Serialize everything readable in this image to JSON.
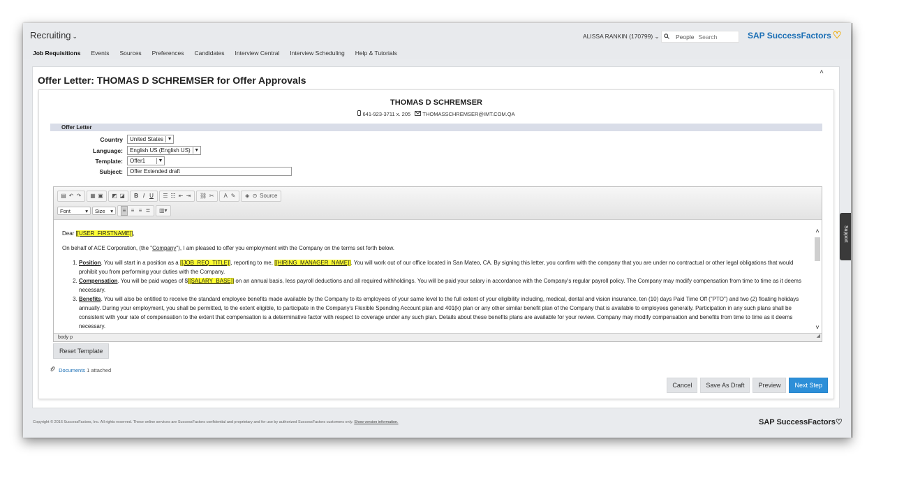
{
  "app": {
    "title": "Recruiting",
    "chevron": "⌄"
  },
  "nav": [
    "Job Requisitions",
    "Events",
    "Sources",
    "Preferences",
    "Candidates",
    "Interview Central",
    "Interview Scheduling",
    "Help & Tutorials"
  ],
  "header": {
    "user": "ALISSA RANKIN (170799) ⌄",
    "search_scope": "People",
    "search_placeholder": "Search",
    "brand": "SAP SuccessFactors",
    "brand_heart": "♡"
  },
  "page": {
    "title": "Offer Letter: THOMAS D SCHREMSER for Offer Approvals",
    "collapse_icon": "˄"
  },
  "candidate": {
    "name": "THOMAS D SCHREMSER",
    "phone": "641-923-3711 x. 205",
    "email": "THOMASSCHREMSER@IMT.COM.QA"
  },
  "section": {
    "title": "Offer Letter"
  },
  "form": {
    "country_label": "Country",
    "country_value": "United States",
    "language_label": "Language:",
    "language_value": "English US (English US)",
    "template_label": "Template:",
    "template_value": "Offer1",
    "subject_label": "Subject:",
    "subject_value": "Offer Extended draft"
  },
  "toolbar": {
    "source_label": "Source",
    "font_label": "Font",
    "size_label": "Size",
    "bold": "B",
    "italic": "I",
    "underline": "U"
  },
  "letter": {
    "dear": "Dear ",
    "user_firstname": "[[USER_FIRSTNAME]]",
    "dear_end": ",",
    "intro_a": "On behalf of ACE Corporation, (the \"",
    "intro_company": "Company",
    "intro_b": "\"), I am pleased to offer you employment with the Company on the terms set forth below.",
    "position_head": "Position",
    "position_a": ". You will start in a position as a ",
    "job_title": "[[JOB_REQ_TITLE]]",
    "position_b": ", reporting to me, ",
    "hiring_manager": "[[HIRING_MANAGER_NAME]]",
    "position_c": ". You will work out of our office located in San Mateo, CA. By signing this letter, you confirm with the company that you are under no contractual or other legal obligations that would prohibit you from performing your duties with the Company.",
    "comp_head": "Compensation",
    "comp_a": ". You will be paid wages of $",
    "salary_base": "[[SALARY_BASE]]",
    "comp_b": " on an annual basis, less payroll deductions and all required withholdings. You will be paid your salary in accordance with the Company's regular payroll policy. The Company may modify compensation from time to time as it deems necessary.",
    "benefits_head": "Benefits",
    "benefits_a": ". You will also be entitled to receive the standard employee benefits made available by the Company to its employees of your same level to the full extent of your eligibility including, medical, dental and vision insurance, ten (10) days Paid Time Off (\"PTO\") and two (2) floating holidays annually. During your employment, you shall be permitted, to the extent eligible, to participate in the Company's Flexible Spending Account plan and 401(k) plan or any other similar benefit plan of the Company that is available to employees generally. Participation in any such plans shall be consistent with your rate of compensation to the extent that compensation is a determinative factor with respect to coverage under any such plan. Details about these benefits plans are available for your review. Company may modify compensation and benefits from time to time as it deems necessary."
  },
  "editor_status": "body  p",
  "reset_button": "Reset Template",
  "documents": {
    "label": "Documents",
    "count": "1 attached"
  },
  "actions": {
    "cancel": "Cancel",
    "save_draft": "Save As Draft",
    "preview": "Preview",
    "next": "Next Step"
  },
  "footer": {
    "copyright": "Copyright © 2016 SuccessFactors, Inc. All rights reserved. These online services are SuccessFactors confidential and proprietary and for use by authorized SuccessFactors customers only.",
    "version_link": "Show version information.",
    "brand": "SAP SuccessFactors",
    "brand_heart": "♡"
  },
  "support": "Support",
  "colors": {
    "brand_blue": "#1b6fb5",
    "primary_button": "#2d8fd8",
    "highlight": "#ffff33",
    "heart": "#f0ab00"
  }
}
